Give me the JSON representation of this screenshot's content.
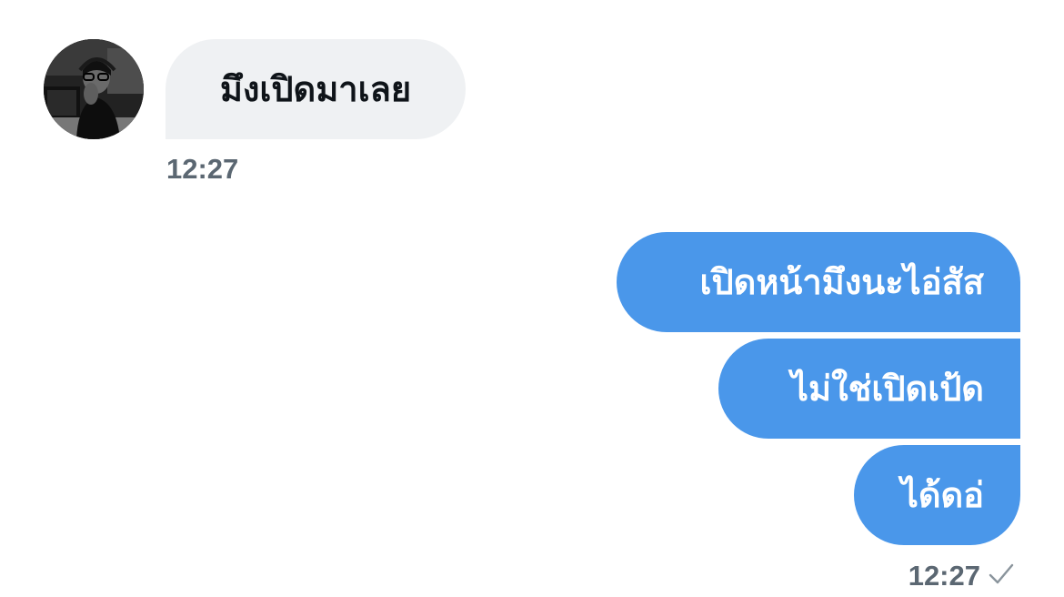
{
  "conversation": {
    "incoming": {
      "avatar": "contact-avatar-photo",
      "text": "มึงเปิดมาเลย",
      "time": "12:27"
    },
    "outgoing": {
      "messages": [
        {
          "text": "เปิดหน้ามึงนะไอ่สัส"
        },
        {
          "text": "ไม่ใช่เปิดเป้ด"
        },
        {
          "text": "ได้ดอ่"
        }
      ],
      "time": "12:27",
      "status_icon": "checkmark-icon"
    }
  },
  "colors": {
    "incoming_bubble": "#eff1f3",
    "outgoing_bubble": "#4a97ea",
    "timestamp": "#5b6772"
  }
}
